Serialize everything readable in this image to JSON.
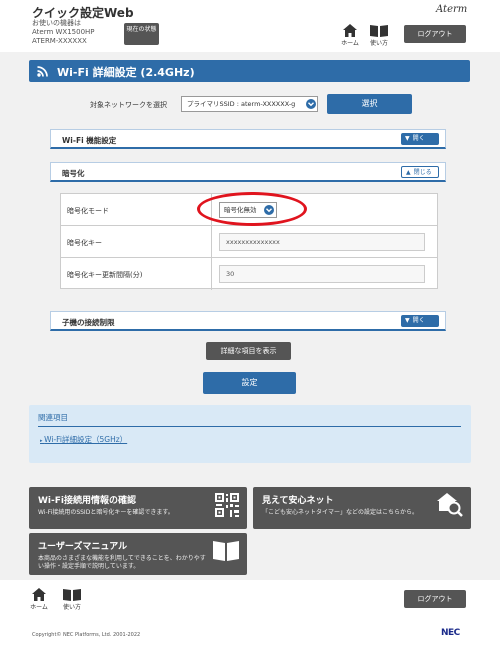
{
  "header": {
    "app_title": "クイック設定Web",
    "device_label": "お使いの機器は",
    "device_model": "Aterm WX1500HP",
    "device_name": "ATERM-XXXXXX",
    "status_button": "現在の状態",
    "brand": "Aterm",
    "home_label": "ホーム",
    "manual_label": "使い方",
    "logout_label": "ログアウト"
  },
  "page": {
    "title": "Wi-Fi 詳細設定 (2.4GHz)"
  },
  "network_selector": {
    "label": "対象ネットワークを選択",
    "value": "プライマリSSID : aterm-XXXXXX-g",
    "button": "選択"
  },
  "sections": {
    "wifi_function": {
      "label": "Wi-Fi 機能設定",
      "toggle": "開く"
    },
    "encryption": {
      "label": "暗号化",
      "toggle": "閉じる"
    },
    "child_restriction": {
      "label": "子機の接続制限",
      "toggle": "開く"
    }
  },
  "encryption_fields": {
    "mode_label": "暗号化モード",
    "mode_value": "暗号化無効",
    "key_label": "暗号化キー",
    "key_value": "xxxxxxxxxxxxxx",
    "interval_label": "暗号化キー更新間隔(分)",
    "interval_value": "30"
  },
  "buttons": {
    "detail": "詳細な項目を表示",
    "apply": "設定"
  },
  "related": {
    "title": "関連項目",
    "link": "Wi-Fi詳細設定（5GHz）"
  },
  "cards": {
    "wifi_info": {
      "title": "Wi-Fi接続用情報の確認",
      "desc": "Wi-Fi接続用のSSIDと暗号化キーを確認できます。"
    },
    "safe_net": {
      "title": "見えて安心ネット",
      "desc": "「こども安心ネットタイマー」などの設定はこちらから。"
    },
    "manual": {
      "title": "ユーザーズマニュアル",
      "desc": "本商品のさまざまな機能を利用してできることを、わかりやすい操作・設定手順で説明しています。"
    }
  },
  "footer": {
    "home_label": "ホーム",
    "manual_label": "使い方",
    "logout_label": "ログアウト",
    "copyright": "Copyright© NEC Platforms, Ltd. 2001-2022",
    "brand": "NEC"
  },
  "colors": {
    "primary": "#2e6ca8",
    "dark_button": "#555555",
    "related_bg": "#d9e9f6",
    "highlight": "#e0141e"
  }
}
